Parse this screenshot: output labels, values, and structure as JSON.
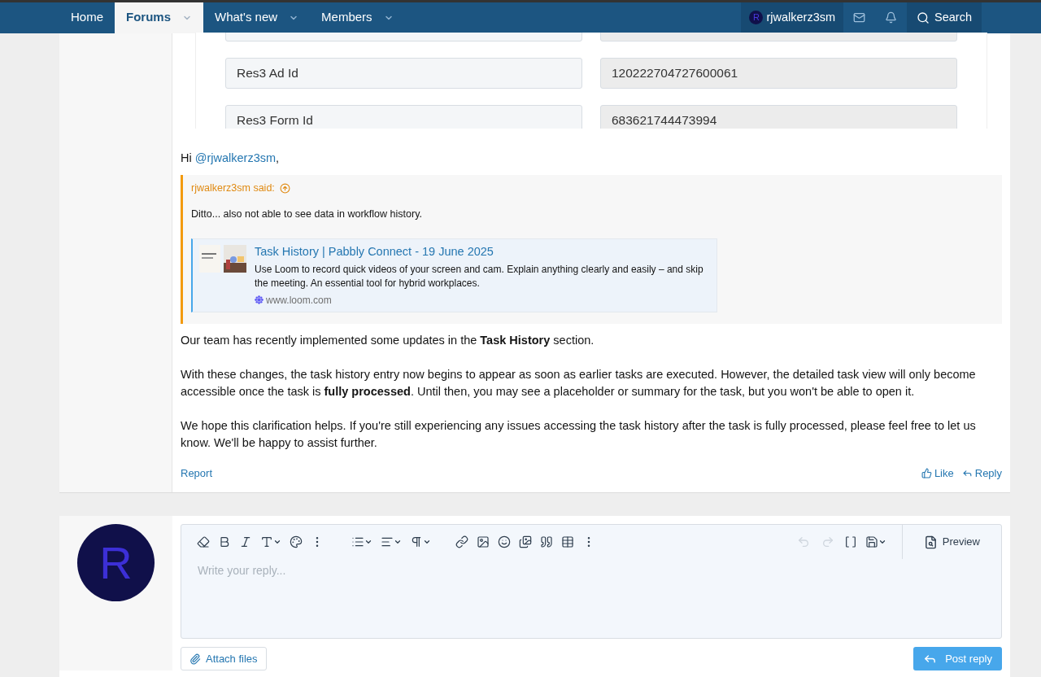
{
  "nav": {
    "items": [
      {
        "label": "Home",
        "selected": false,
        "has_menu": false
      },
      {
        "label": "Forums",
        "selected": true,
        "has_menu": true
      },
      {
        "label": "What's new",
        "selected": false,
        "has_menu": true
      },
      {
        "label": "Members",
        "selected": false,
        "has_menu": true
      }
    ],
    "user": {
      "avatar_letter": "R",
      "name": "rjwalkerz3sm"
    },
    "search_label": "Search"
  },
  "form_fields": [
    {
      "label": "Res3 Ad Id",
      "value": "120222704727600061"
    },
    {
      "label": "Res3 Form Id",
      "value": "683621744473994"
    }
  ],
  "post": {
    "greeting": "Hi ",
    "mention": "@rjwalkerz3sm",
    "greeting_end": ",",
    "quote": {
      "author": "rjwalkerz3sm said:",
      "text": "Ditto... also not able to see data in workflow history.",
      "embed": {
        "title": "Task History | Pabbly Connect - 19 June 2025",
        "description": "Use Loom to record quick videos of your screen and cam. Explain anything clearly and easily – and skip the meeting. An essential tool for hybrid workplaces.",
        "site": "www.loom.com"
      }
    },
    "paragraphs": [
      "Our team has recently implemented some updates in the **Task History** section.",
      "With these changes, the task history entry now begins to appear as soon as earlier tasks are executed. However, the detailed task view will only become accessible once the task is **fully processed**. Until then, you may see a placeholder or summary for the task, but you won't be able to open it.",
      "We hope this clarification helps. If you're still experiencing any issues accessing the task history after the task is fully processed, please feel free to let us know. We'll be happy to assist further."
    ],
    "report": "Report",
    "like": "Like",
    "reply": "Reply"
  },
  "editor": {
    "avatar_letter": "R",
    "placeholder": "Write your reply...",
    "history_buttons": [
      {
        "kind": "undo",
        "disabled": true
      },
      {
        "kind": "redo",
        "disabled": true
      }
    ],
    "preview": "Preview",
    "attach": "Attach files",
    "post": "Post reply"
  }
}
